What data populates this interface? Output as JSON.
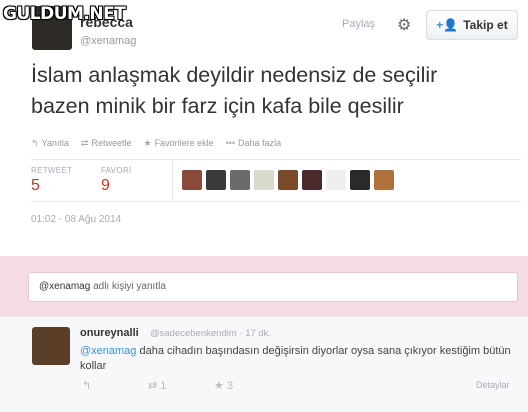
{
  "watermark": "GULDUM.NET",
  "author": {
    "display_name": "rebecca",
    "handle": "@xenamag"
  },
  "header": {
    "share_label": "Paylaş",
    "gear_icon": "gear-icon",
    "follow_label": "Takip et"
  },
  "tweet": {
    "line1": "İslam anlaşmak deyildir nedensiz de seçilir",
    "line2": "bazen minik bir farz için kafa bile qesilir",
    "actions": {
      "reply": "Yanıtla",
      "retweet": "Retweetle",
      "favorite": "Favorilere ekle",
      "more": "Daha fazla"
    },
    "stats": {
      "retweet_label": "RETWEET",
      "retweet_count": "5",
      "favorite_label": "FAVORİ",
      "favorite_count": "9"
    },
    "timestamp": "01:02 - 08 Ağu 2014"
  },
  "favoriters": [
    {
      "color": "#8a4a3a"
    },
    {
      "color": "#3a3a3a"
    },
    {
      "color": "#6a6a6a"
    },
    {
      "color": "#d9d9cc"
    },
    {
      "color": "#7a4a2a"
    },
    {
      "color": "#4a2a2a"
    },
    {
      "color": "#efefef"
    },
    {
      "color": "#2a2a2a"
    },
    {
      "color": "#b0703a"
    }
  ],
  "reply_box": {
    "mention": "@xenamag",
    "suffix": " adlı kişiyi yanıtla"
  },
  "reply": {
    "name": "onureynalli",
    "meta": "@sadecebenkendim · 17 dk.",
    "mention": "@xenamag",
    "text": " daha cihadın başındasın değişirsin diyorlar oysa sana çıkıyor kestiğim bütün kollar",
    "retweet_count": "1",
    "favorite_count": "3",
    "details": "Detaylar"
  }
}
